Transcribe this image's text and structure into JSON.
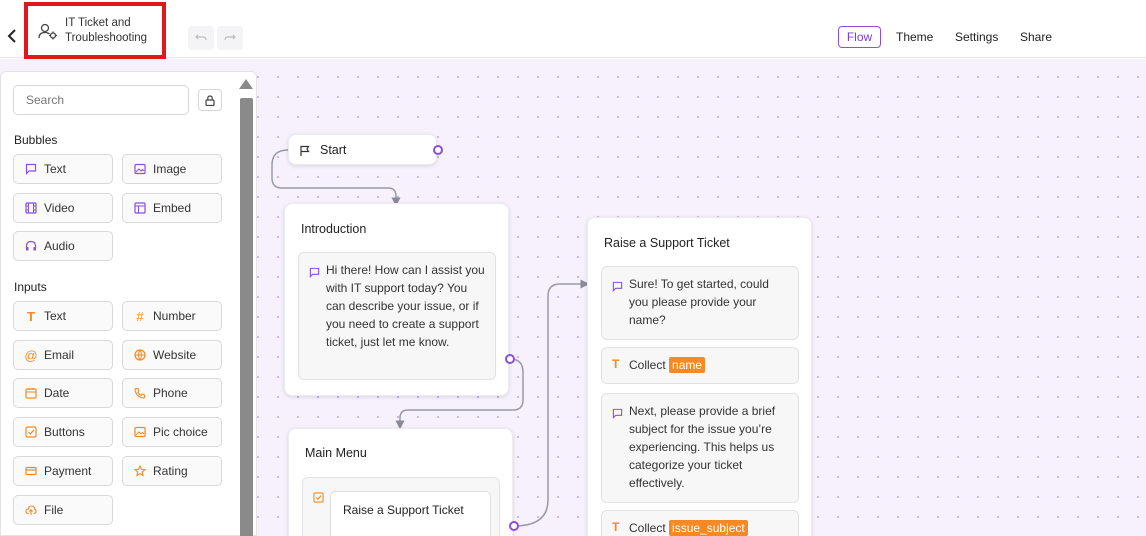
{
  "header": {
    "title": "IT Ticket and Troubleshooting",
    "nav": {
      "flow": "Flow",
      "theme": "Theme",
      "settings": "Settings",
      "share": "Share"
    }
  },
  "sidebar": {
    "search_placeholder": "Search",
    "bubbles_title": "Bubbles",
    "bubbles": [
      "Text",
      "Image",
      "Video",
      "Embed",
      "Audio"
    ],
    "inputs_title": "Inputs",
    "inputs": [
      "Text",
      "Number",
      "Email",
      "Website",
      "Date",
      "Phone",
      "Buttons",
      "Pic choice",
      "Payment",
      "Rating",
      "File"
    ]
  },
  "flow": {
    "start": {
      "label": "Start"
    },
    "introduction": {
      "title": "Introduction",
      "message": "Hi there! How can I assist you with IT support today? You can describe your issue, or if you need to create a support ticket, just let me know."
    },
    "main_menu": {
      "title": "Main Menu",
      "button_item": "Raise a Support Ticket"
    },
    "support_ticket": {
      "title": "Raise a Support Ticket",
      "message1": "Sure! To get started, could you please provide your name?",
      "collect_label": "Collect",
      "var_name": "name",
      "message2": "Next, please provide a brief subject for the issue you’re experiencing. This helps us categorize your ticket effectively.",
      "collect_label2": "Collect",
      "var_subject": "issue_subject"
    }
  },
  "colors": {
    "accent": "#8a4fe0",
    "variable": "#f58a24",
    "highlight": "#e0171b",
    "canvas": "#f7f1fd"
  }
}
